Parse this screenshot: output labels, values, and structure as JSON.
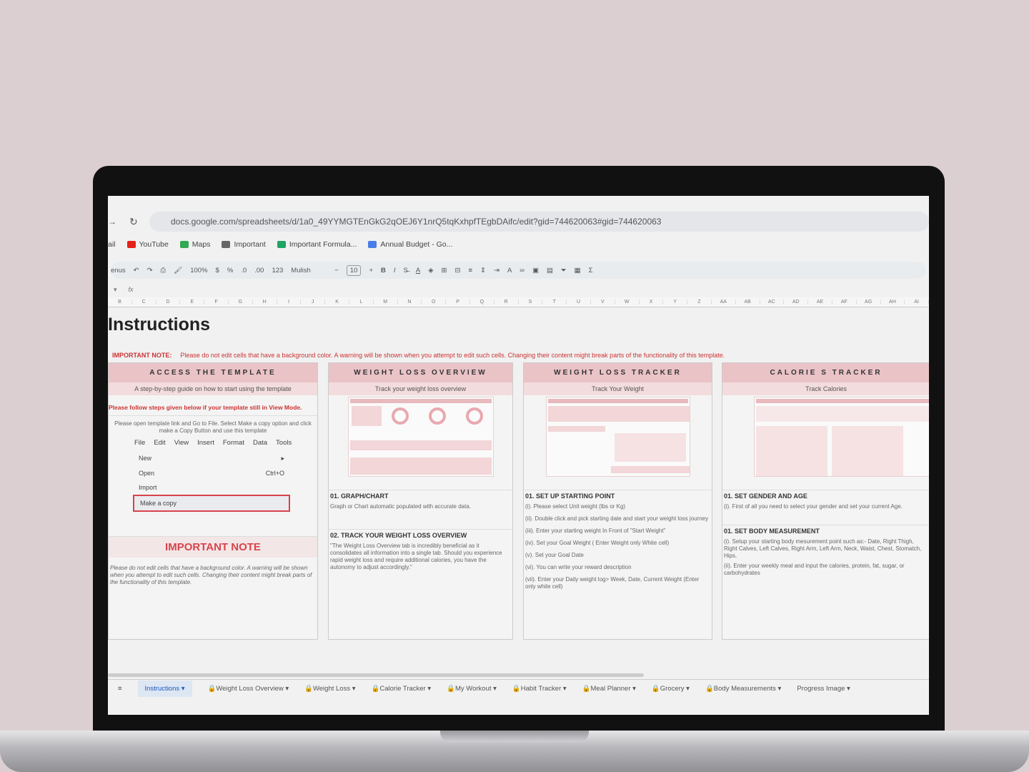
{
  "browser": {
    "url": "docs.google.com/spreadsheets/d/1a0_49YYMGTEnGkG2qOEJ6Y1nrQ5tqKxhpfTEgbDAifc/edit?gid=744620063#gid=744620063",
    "bookmarks": [
      {
        "label": "ail",
        "color": "#888"
      },
      {
        "label": "YouTube",
        "color": "#e62117"
      },
      {
        "label": "Maps",
        "color": "#34a853"
      },
      {
        "label": "Important",
        "color": "#666"
      },
      {
        "label": "Important Formula...",
        "color": "#1fa463"
      },
      {
        "label": "Annual Budget - Go...",
        "color": "#4a7de8"
      }
    ]
  },
  "toolbar": {
    "menus": "enus",
    "zoom": "100%",
    "currency": "$",
    "percent": "%",
    "dec_less": ".0",
    "dec_more": ".00",
    "format_123": "123",
    "font": "Mulish",
    "font_size": "10",
    "bold": "B",
    "italic": "I",
    "fx": "fx"
  },
  "columns": [
    "B",
    "C",
    "D",
    "E",
    "F",
    "G",
    "H",
    "I",
    "J",
    "K",
    "L",
    "M",
    "N",
    "O",
    "P",
    "Q",
    "R",
    "S",
    "T",
    "U",
    "V",
    "W",
    "X",
    "Y",
    "Z",
    "AA",
    "AB",
    "AC",
    "AD",
    "AE",
    "AF",
    "AG",
    "AH",
    "AI"
  ],
  "sheet": {
    "title": "Instructions",
    "note_label": "IMPORTANT NOTE:",
    "note_text": "Please do not edit cells that have a background color. A warning will be shown when you attempt to edit such cells. Changing their content might break parts of the functionality of this template."
  },
  "access": {
    "title": "ACCESS THE TEMPLATE",
    "subtitle": "A step-by-step guide on how to start using the template",
    "view_mode": "Please follow steps given below if your template still in View Mode.",
    "instructions": "Please open template link and Go to File. Select Make a copy option and click make a Copy Button and use this template",
    "menu": [
      "File",
      "Edit",
      "View",
      "Insert",
      "Format",
      "Data",
      "Tools"
    ],
    "items": [
      {
        "label": "New",
        "shortcut": "▸"
      },
      {
        "label": "Open",
        "shortcut": "Ctrl+O"
      },
      {
        "label": "Import",
        "shortcut": ""
      },
      {
        "label": "Make a copy",
        "shortcut": ""
      }
    ],
    "important_title": "IMPORTANT NOTE",
    "important_text": "Please do not edit cells that have a background color. A warning will be shown when you attempt to edit such cells. Changing their content might break parts of the functionality of this template."
  },
  "overview": {
    "title": "WEIGHT LOSS OVERVIEW",
    "subtitle": "Track your weight loss overview",
    "s1": "01. GRAPH/CHART",
    "p1": "Graph or Chart automatic populated with accurate data.",
    "s2": "02. TRACK YOUR WEIGHT LOSS OVERVIEW",
    "p2": "\"The Weight Loss Overview tab is incredibly beneficial as it consolidates all information into a single tab. Should you experience rapid weight loss and require additional calories, you have the autonomy to adjust accordingly.\""
  },
  "tracker": {
    "title": "WEIGHT LOSS TRACKER",
    "subtitle": "Track Your Weight",
    "s1": "01. SET UP STARTING POINT",
    "steps": [
      "(i). Please select Unit weight (lbs or Kg)",
      "(ii). Double click and pick starting date and start your weight loss journey",
      "(iii). Enter your starting weight In Front of \"Start Weight\"",
      "(iv). Set your Goal Weight ( Enter Weight only White cell)",
      "(v). Set your Goal Date",
      "(vi). You can write your reward description",
      "(vii). Enter your Daily weight log> Week, Date, Current Weight (Enter only white cell)"
    ]
  },
  "calorie": {
    "title": "CALORIE S TRACKER",
    "subtitle": "Track Calories",
    "s1": "01. SET GENDER AND AGE",
    "p1": "(i). First of all you need to select your gender and set your current Age.",
    "s2": "01. SET BODY MEASUREMENT",
    "p2": "(i). Setup your starting body mesurement point such as:- Date, Right Thigh, Right Calves, Left Calves, Right Arm, Left Arm, Neck, Waist, Chest, Stomatch, Hips.",
    "p3": "(ii). Enter your weekly meal and input the calories, protein, fat, sugar, or carbohydrates"
  },
  "tabs": [
    {
      "label": "Instructions ▾",
      "locked": false,
      "active": true
    },
    {
      "label": "Weight Loss Overview ▾",
      "locked": true
    },
    {
      "label": "Weight Loss ▾",
      "locked": true
    },
    {
      "label": "Calorie Tracker ▾",
      "locked": true
    },
    {
      "label": "My Workout ▾",
      "locked": true
    },
    {
      "label": "Habit Tracker ▾",
      "locked": true
    },
    {
      "label": "Meal Planner ▾",
      "locked": true
    },
    {
      "label": "Grocery ▾",
      "locked": true
    },
    {
      "label": "Body Measurements ▾",
      "locked": true
    },
    {
      "label": "Progress Image ▾",
      "locked": false
    }
  ],
  "colors": {
    "accent_pink": "#eac3c6",
    "note_red": "#c33333",
    "active_tab": "#1a57c4"
  }
}
